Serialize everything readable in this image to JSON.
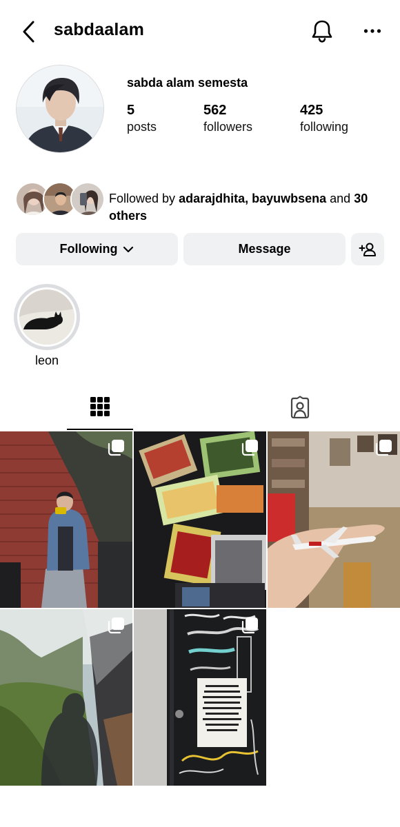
{
  "header": {
    "username": "sabdaalam",
    "back_icon": "chevron-left-icon",
    "notification_icon": "bell-icon",
    "more_icon": "more-horizontal-icon"
  },
  "profile": {
    "full_name": "sabda alam semesta",
    "stats": {
      "posts": {
        "value": "5",
        "label": "posts"
      },
      "followers": {
        "value": "562",
        "label": "followers"
      },
      "following": {
        "value": "425",
        "label": "following"
      }
    }
  },
  "followed_by": {
    "prefix": "Followed by ",
    "names": "adarajdhita, bayuwbsena",
    "middle": " and ",
    "others": "30 others"
  },
  "actions": {
    "following_label": "Following",
    "message_label": "Message",
    "add_user_icon": "add-user-icon"
  },
  "highlights": [
    {
      "label": "leon"
    }
  ],
  "tabs": {
    "grid_icon": "grid-icon",
    "tagged_icon": "tagged-icon"
  },
  "posts": [
    {
      "multiple": true
    },
    {
      "multiple": true
    },
    {
      "multiple": true
    },
    {
      "multiple": true
    },
    {
      "multiple": true
    }
  ],
  "colors": {
    "button_bg": "#eff1f3",
    "text": "#000000",
    "divider": "#dbdbdb"
  }
}
